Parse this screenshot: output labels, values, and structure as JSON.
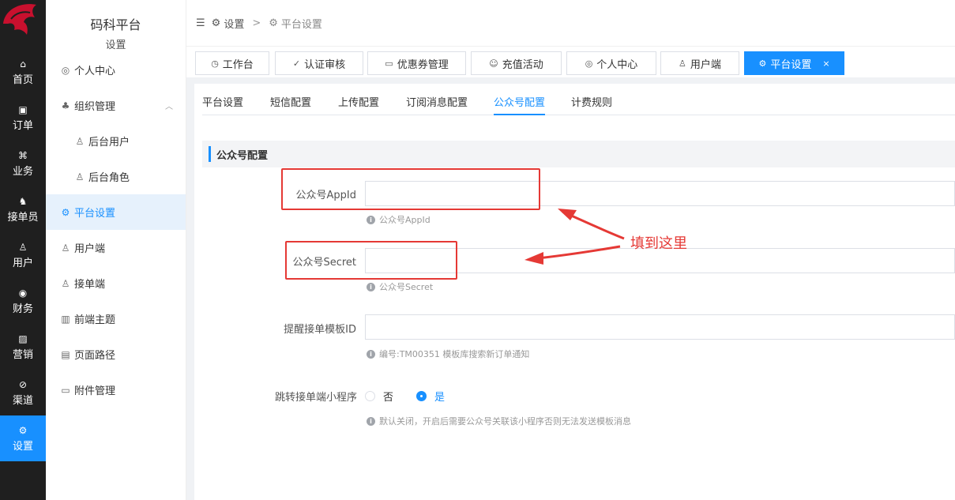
{
  "rail": {
    "items": [
      {
        "label": "首页",
        "icon": "home-icon",
        "glyph": "⌂"
      },
      {
        "label": "订单",
        "icon": "order-icon",
        "glyph": "▣"
      },
      {
        "label": "业务",
        "icon": "business-icon",
        "glyph": "⌘"
      },
      {
        "label": "接单员",
        "icon": "bike-icon",
        "glyph": "♞"
      },
      {
        "label": "用户",
        "icon": "user-icon",
        "glyph": "♙"
      },
      {
        "label": "财务",
        "icon": "finance-icon",
        "glyph": "◉"
      },
      {
        "label": "营销",
        "icon": "chart-icon",
        "glyph": "▨"
      },
      {
        "label": "渠道",
        "icon": "channel-icon",
        "glyph": "⊘"
      },
      {
        "label": "设置",
        "icon": "settings-icon",
        "glyph": "⚙",
        "active": true
      }
    ]
  },
  "sidebar": {
    "title": "码科平台",
    "subtitle": "设置",
    "items": [
      {
        "label": "个人中心",
        "glyph": "◎"
      },
      {
        "label": "组织管理",
        "glyph": "♣",
        "caret": "︿"
      },
      {
        "label": "后台用户",
        "glyph": "♙"
      },
      {
        "label": "后台角色",
        "glyph": "♙"
      },
      {
        "label": "平台设置",
        "glyph": "⚙"
      },
      {
        "label": "用户端",
        "glyph": "♙"
      },
      {
        "label": "接单端",
        "glyph": "♙"
      },
      {
        "label": "前端主题",
        "glyph": "▥"
      },
      {
        "label": "页面路径",
        "glyph": "▤"
      },
      {
        "label": "附件管理",
        "glyph": "▭"
      }
    ]
  },
  "breadcrumb": {
    "toggle_glyph": "☰",
    "home_glyph": "⚙",
    "first": "设置",
    "sep": ">",
    "current_glyph": "⚙",
    "current": "平台设置"
  },
  "tags": [
    {
      "label": "工作台",
      "glyph": "◷"
    },
    {
      "label": "认证审核",
      "glyph": "✓"
    },
    {
      "label": "优惠券管理",
      "glyph": "▭"
    },
    {
      "label": "充值活动",
      "glyph": "☺"
    },
    {
      "label": "个人中心",
      "glyph": "◎"
    },
    {
      "label": "用户端",
      "glyph": "♙"
    },
    {
      "label": "平台设置",
      "glyph": "⚙",
      "close": "×"
    }
  ],
  "subtabs": [
    "平台设置",
    "短信配置",
    "上传配置",
    "订阅消息配置",
    "公众号配置",
    "计费规则"
  ],
  "section_title": "公众号配置",
  "form": {
    "appid_label": "公众号AppId",
    "appid_value": "",
    "appid_hint": "公众号AppId",
    "secret_label": "公众号Secret",
    "secret_value": "",
    "secret_hint": "公众号Secret",
    "template_label": "提醒接单模板ID",
    "template_value": "",
    "template_hint": "编号:TM00351 模板库搜索新订单通知",
    "jump_label": "跳转接单端小程序",
    "jump_no": "否",
    "jump_yes": "是",
    "jump_hint": "默认关闭，开启后需要公众号关联该小程序否则无法发送模板消息",
    "hint_glyph": "i"
  },
  "annotation": "填到这里",
  "colors": {
    "accent": "#1890ff",
    "annotation": "#e53935",
    "rail": "#1f1f1f"
  }
}
